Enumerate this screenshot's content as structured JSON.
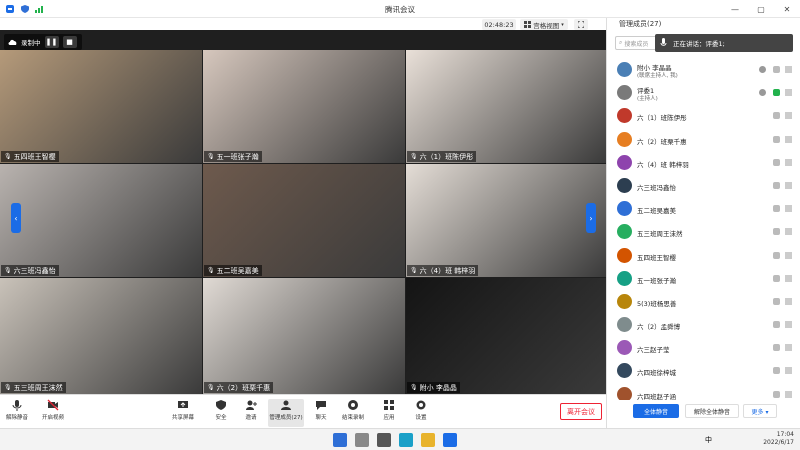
{
  "window": {
    "title": "腾讯会议",
    "timer": "02:48:23",
    "view_label": "宫格视图",
    "members_label": "管理成员(27)"
  },
  "recording": {
    "label": "录制中"
  },
  "tiles": [
    {
      "name": "五四班王智樱",
      "color": "#b59a7a"
    },
    {
      "name": "五一班张子瀚",
      "color": "#d6c7bd"
    },
    {
      "name": "六（1）班陈伊彤",
      "color": "#e9e0d8"
    },
    {
      "name": "六三班冯鑫怡",
      "color": "#b9b3af"
    },
    {
      "name": "五二班吴嘉美",
      "color": "#6e5a4d"
    },
    {
      "name": "六（4）班 韩梓羽",
      "color": "#e4ddd6"
    },
    {
      "name": "五三班周王沫然",
      "color": "#c9c2b9"
    },
    {
      "name": "六（2）班栗千惠",
      "color": "#e0dad4"
    },
    {
      "name": "附小 李晶晶",
      "color": "#141414"
    }
  ],
  "toolbar": {
    "mute": "解除静音",
    "video": "开启视频",
    "share": "共享屏幕",
    "security": "安全",
    "invite": "邀请",
    "members": "管理成员(27)",
    "chat": "聊天",
    "record": "结束录制",
    "apps": "应用",
    "settings": "设置",
    "leave": "离开会议"
  },
  "panel": {
    "title": "管理成员(27)",
    "search_placeholder": "搜索成员",
    "speaking": "正在讲话：评委1;",
    "participants": [
      {
        "name": "附小 李晶晶",
        "role": "(联席主持人, 我)",
        "color": "#4a7fb5"
      },
      {
        "name": "评委1",
        "role": "(主持人)",
        "color": "#7a7a7a"
      },
      {
        "name": "六（1）班陈伊彤",
        "color": "#c0392b"
      },
      {
        "name": "六（2）班栗千惠",
        "color": "#e67e22"
      },
      {
        "name": "六（4）班 韩梓羽",
        "color": "#8e44ad"
      },
      {
        "name": "六三班冯鑫怡",
        "color": "#2c3e50"
      },
      {
        "name": "五二班吴嘉美",
        "color": "#2f6fd6"
      },
      {
        "name": "五三班周王沫然",
        "color": "#27ae60"
      },
      {
        "name": "五四班王智樱",
        "color": "#d35400"
      },
      {
        "name": "五一班张子瀚",
        "color": "#16a085"
      },
      {
        "name": "5(3)班杨思善",
        "color": "#b8860b"
      },
      {
        "name": "六（2）孟舜博",
        "color": "#7f8c8d"
      },
      {
        "name": "六三赵子莹",
        "color": "#9b59b6"
      },
      {
        "name": "六四班徐梓城",
        "color": "#34495e"
      },
      {
        "name": "六四班赵子涵",
        "color": "#a0522d"
      }
    ],
    "mute_all": "全体静音",
    "unmute_all": "解除全体静音",
    "more": "更多 ▾"
  },
  "taskbar": {
    "ime": "中",
    "time": "17:04",
    "date": "2022/6/17"
  },
  "colors": {
    "accent": "#1b6ce6",
    "danger": "#e22233",
    "unmute_mic": "#22b24c"
  }
}
